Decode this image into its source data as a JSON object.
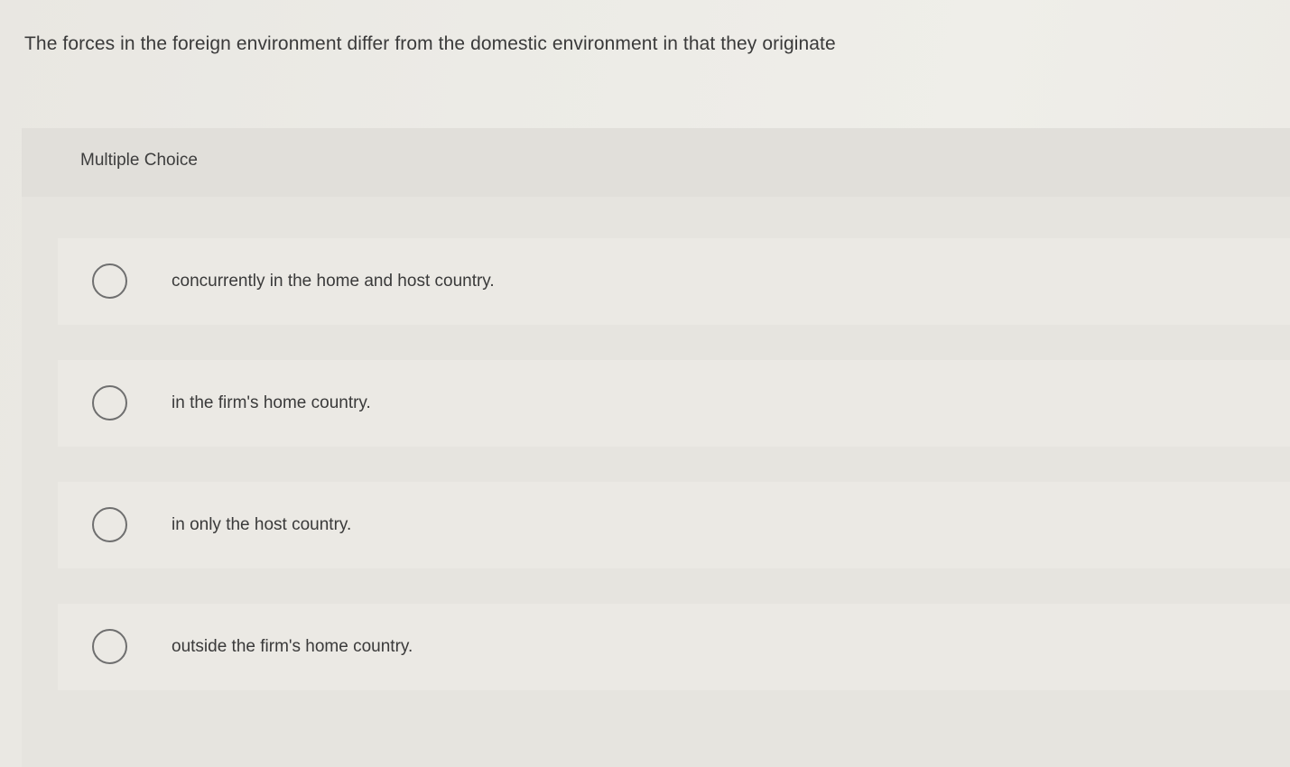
{
  "question": {
    "text": "The forces in the foreign environment differ from the domestic environment in that they originate"
  },
  "panel": {
    "label": "Multiple Choice"
  },
  "options": [
    {
      "label": "concurrently in the home and host country."
    },
    {
      "label": "in the firm's home country."
    },
    {
      "label": "in only the host country."
    },
    {
      "label": "outside the firm's home country."
    }
  ],
  "colors": {
    "background": "#ecebe6",
    "panel": "#e6e4df",
    "option_row": "#ebe9e4",
    "radio_border": "#6f6f6f",
    "text": "#3a3a3a"
  },
  "icons": {
    "radio": "radio-unchecked-icon"
  }
}
